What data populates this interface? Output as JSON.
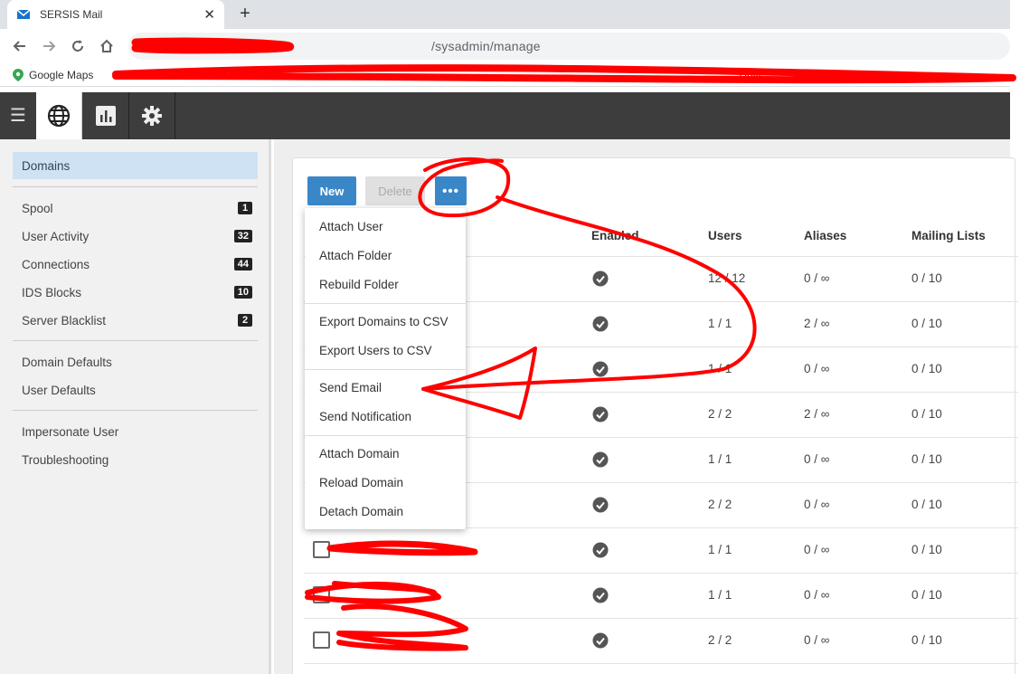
{
  "browser": {
    "tab_title": "SERSIS Mail",
    "url": "/sysadmin/manage",
    "bookmarks": [
      {
        "label": "Google Maps"
      },
      {
        "label": "Unifi"
      }
    ]
  },
  "nav": {
    "items": [
      {
        "label": "Domains",
        "count": ""
      },
      {
        "label": "Spool",
        "count": "1"
      },
      {
        "label": "User Activity",
        "count": "32"
      },
      {
        "label": "Connections",
        "count": "44"
      },
      {
        "label": "IDS Blocks",
        "count": "10"
      },
      {
        "label": "Server Blacklist",
        "count": "2"
      },
      {
        "label": "Domain Defaults",
        "count": ""
      },
      {
        "label": "User Defaults",
        "count": ""
      },
      {
        "label": "Impersonate User",
        "count": ""
      },
      {
        "label": "Troubleshooting",
        "count": ""
      }
    ]
  },
  "toolbar": {
    "new_label": "New",
    "delete_label": "Delete",
    "more_label": "•••"
  },
  "menu": {
    "items": [
      {
        "label": "Attach User"
      },
      {
        "label": "Attach Folder"
      },
      {
        "label": "Rebuild Folder"
      },
      {
        "label": "Export Domains to CSV"
      },
      {
        "label": "Export Users to CSV"
      },
      {
        "label": "Send Email"
      },
      {
        "label": "Send Notification"
      },
      {
        "label": "Attach Domain"
      },
      {
        "label": "Reload Domain"
      },
      {
        "label": "Detach Domain"
      }
    ]
  },
  "table": {
    "columns": {
      "enabled": "Enabled",
      "users": "Users",
      "aliases": "Aliases",
      "lists": "Mailing Lists"
    },
    "rows": [
      {
        "users": "12 / 12",
        "aliases": "0 / ∞",
        "lists": "0 / 10"
      },
      {
        "users": "1 / 1",
        "aliases": "2 / ∞",
        "lists": "0 / 10"
      },
      {
        "users": "1 / 1",
        "aliases": "0 / ∞",
        "lists": "0 / 10"
      },
      {
        "users": "2 / 2",
        "aliases": "2 / ∞",
        "lists": "0 / 10"
      },
      {
        "users": "1 / 1",
        "aliases": "0 / ∞",
        "lists": "0 / 10"
      },
      {
        "users": "2 / 2",
        "aliases": "0 / ∞",
        "lists": "0 / 10"
      },
      {
        "users": "1 / 1",
        "aliases": "0 / ∞",
        "lists": "0 / 10"
      },
      {
        "users": "1 / 1",
        "aliases": "0 / ∞",
        "lists": "0 / 10"
      },
      {
        "users": "2 / 2",
        "aliases": "0 / ∞",
        "lists": "0 / 10"
      }
    ]
  },
  "colors": {
    "accent": "#3a87c8",
    "appbar": "#3d3d3d",
    "annotation": "#ff0000"
  }
}
